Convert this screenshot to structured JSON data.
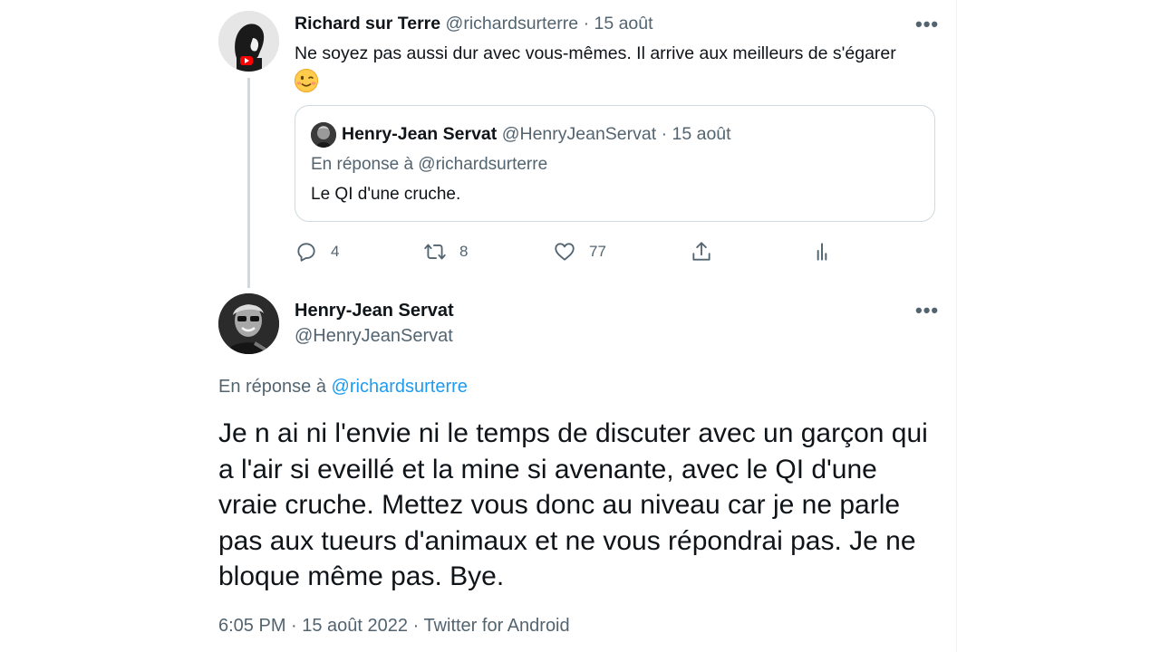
{
  "parent_tweet": {
    "author_name": "Richard sur Terre",
    "author_handle": "@richardsurterre",
    "separator": "·",
    "date": "15 août",
    "text": "Ne soyez pas aussi dur avec vous-mêmes. Il arrive aux meilleurs de s'égarer",
    "emoji": "winking-face",
    "quoted": {
      "author_name": "Henry-Jean Servat",
      "author_handle": "@HenryJeanServat",
      "separator": "·",
      "date": "15 août",
      "reply_context": "En réponse à @richardsurterre",
      "text": "Le QI d'une cruche."
    },
    "actions": {
      "reply_count": "4",
      "retweet_count": "8",
      "like_count": "77"
    },
    "more_label": "•••"
  },
  "main_tweet": {
    "author_name": "Henry-Jean Servat",
    "author_handle": "@HenryJeanServat",
    "reply_prefix": "En réponse à",
    "reply_to": "@richardsurterre",
    "text": "Je n ai ni l'envie ni le temps de discuter avec un garçon qui a l'air si eveillé et la mine si avenante, avec le QI d'une vraie cruche. Mettez vous donc au niveau car je ne parle pas aux tueurs d'animaux et ne vous répondrai pas. Je ne bloque même pas. Bye.",
    "timestamp": "6:05 PM · 15 août 2022 · Twitter for Android",
    "more_label": "•••"
  },
  "colors": {
    "text": "#0f1419",
    "muted": "#536471",
    "link": "#1d9bf0",
    "border": "#cfd9de"
  }
}
